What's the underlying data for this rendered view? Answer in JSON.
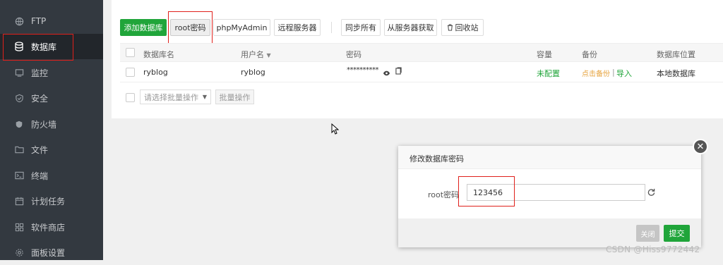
{
  "sidebar": {
    "items": [
      {
        "label": "FTP",
        "icon": "globe-icon"
      },
      {
        "label": "数据库",
        "icon": "database-icon",
        "active": true
      },
      {
        "label": "监控",
        "icon": "monitor-icon"
      },
      {
        "label": "安全",
        "icon": "shield-check-icon"
      },
      {
        "label": "防火墙",
        "icon": "shield-icon"
      },
      {
        "label": "文件",
        "icon": "folder-icon"
      },
      {
        "label": "终端",
        "icon": "terminal-icon"
      },
      {
        "label": "计划任务",
        "icon": "calendar-icon"
      },
      {
        "label": "软件商店",
        "icon": "apps-icon"
      },
      {
        "label": "面板设置",
        "icon": "gear-icon"
      }
    ]
  },
  "toolbar": {
    "add_db": "添加数据库",
    "root_pwd": "root密码",
    "phpmyadmin": "phpMyAdmin",
    "remote_server": "远程服务器",
    "sync_all": "同步所有",
    "fetch_from_server": "从服务器获取",
    "recycle_bin": "回收站"
  },
  "table": {
    "headers": {
      "name": "数据库名",
      "user": "用户名",
      "password": "密码",
      "capacity": "容量",
      "backup": "备份",
      "location": "数据库位置"
    },
    "rows": [
      {
        "name": "ryblog",
        "user": "ryblog",
        "password": "**********",
        "capacity": "未配置",
        "backup_link": "点击备份",
        "backup_sep": "|",
        "import_link": "导入",
        "location": "本地数据库"
      }
    ]
  },
  "batch": {
    "select_placeholder": "请选择批量操作",
    "button": "批量操作"
  },
  "modal": {
    "title": "修改数据库密码",
    "field_label": "root密码",
    "field_value": "123456",
    "close_button": "关闭",
    "submit_button": "提交"
  },
  "watermark": "CSDN @Hiss9772442",
  "colors": {
    "sidebar_bg": "#333940",
    "accent_green": "#20a53a",
    "warning_orange": "#e6a23c",
    "highlight_red": "#e0201b"
  }
}
